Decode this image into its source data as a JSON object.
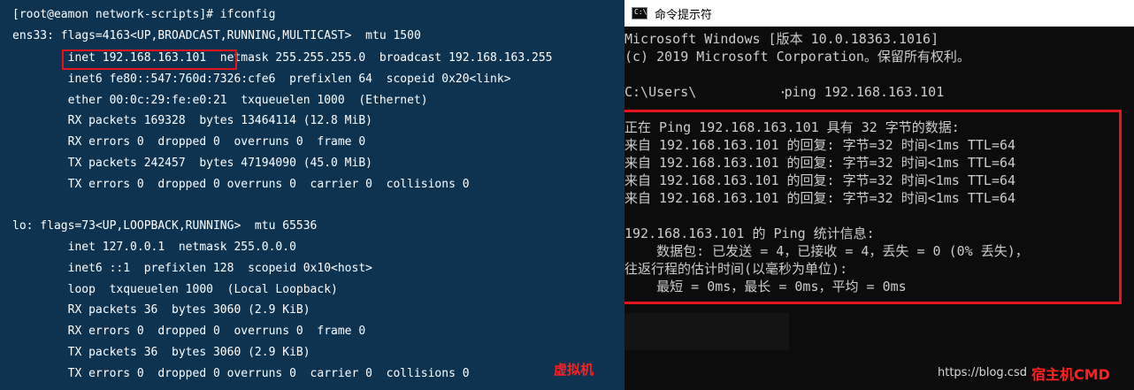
{
  "linux_terminal": {
    "lines": [
      "[root@eamon network-scripts]# ifconfig",
      "ens33: flags=4163<UP,BROADCAST,RUNNING,MULTICAST>  mtu 1500",
      "        inet 192.168.163.101  netmask 255.255.255.0  broadcast 192.168.163.255",
      "        inet6 fe80::547:760d:7326:cfe6  prefixlen 64  scopeid 0x20<link>",
      "        ether 00:0c:29:fe:e0:21  txqueuelen 1000  (Ethernet)",
      "        RX packets 169328  bytes 13464114 (12.8 MiB)",
      "        RX errors 0  dropped 0  overruns 0  frame 0",
      "        TX packets 242457  bytes 47194090 (45.0 MiB)",
      "        TX errors 0  dropped 0 overruns 0  carrier 0  collisions 0",
      "",
      "lo: flags=73<UP,LOOPBACK,RUNNING>  mtu 65536",
      "        inet 127.0.0.1  netmask 255.0.0.0",
      "        inet6 ::1  prefixlen 128  scopeid 0x10<host>",
      "        loop  txqueuelen 1000  (Local Loopback)",
      "        RX packets 36  bytes 3060 (2.9 KiB)",
      "        RX errors 0  dropped 0  overruns 0  frame 0",
      "        TX packets 36  bytes 3060 (2.9 KiB)",
      "        TX errors 0  dropped 0 overruns 0  carrier 0  collisions 0"
    ],
    "annotation": "虚拟机"
  },
  "cmd_window": {
    "title": "命令提示符",
    "icon_text": "C:\\",
    "lines": [
      "Microsoft Windows [版本 10.0.18363.1016]",
      "(c) 2019 Microsoft Corporation。保留所有权利。",
      "",
      "C:\\Users\\          >ping 192.168.163.101",
      "",
      "正在 Ping 192.168.163.101 具有 32 字节的数据:",
      "来自 192.168.163.101 的回复: 字节=32 时间<1ms TTL=64",
      "来自 192.168.163.101 的回复: 字节=32 时间<1ms TTL=64",
      "来自 192.168.163.101 的回复: 字节=32 时间<1ms TTL=64",
      "来自 192.168.163.101 的回复: 字节=32 时间<1ms TTL=64",
      "",
      "192.168.163.101 的 Ping 统计信息:",
      "    数据包: 已发送 = 4，已接收 = 4，丢失 = 0 (0% 丢失)，",
      "往返行程的估计时间(以毫秒为单位):",
      "    最短 = 0ms，最长 = 0ms，平均 = 0ms"
    ],
    "watermark": "https://blog.csd",
    "annotation": "宿主机CMD"
  }
}
